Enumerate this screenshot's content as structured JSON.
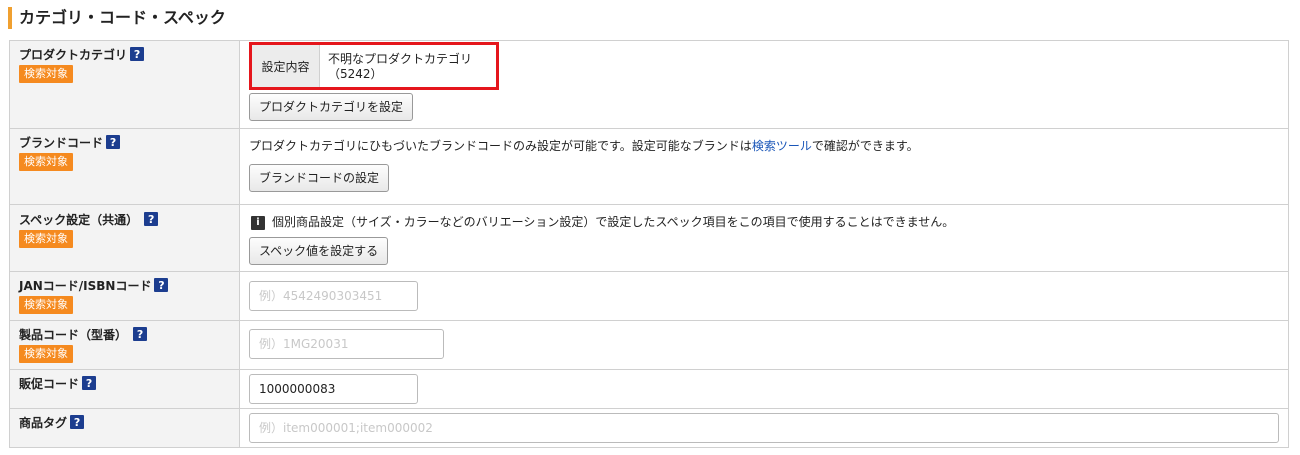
{
  "section_title": "カテゴリ・コード・スペック",
  "search_badge": "検索対象",
  "help_glyph": "?",
  "rows": {
    "product_category": {
      "label": "プロダクトカテゴリ",
      "setting_key": "設定内容",
      "setting_value_line1": "不明なプロダクトカテゴリ",
      "setting_value_line2": "（5242）",
      "button": "プロダクトカテゴリを設定"
    },
    "brand_code": {
      "label": "ブランドコード",
      "desc_before": "プロダクトカテゴリにひもづいたブランドコードのみ設定が可能です。設定可能なブランドは",
      "desc_link": "検索ツール",
      "desc_after": "で確認ができます。",
      "button": "ブランドコードの設定"
    },
    "spec": {
      "label": "スペック設定（共通）",
      "info_glyph": "i",
      "info_text": "個別商品設定（サイズ・カラーなどのバリエーション設定）で設定したスペック項目をこの項目で使用することはできません。",
      "button": "スペック値を設定する"
    },
    "jan": {
      "label": "JANコード/ISBNコード",
      "placeholder": "例）4542490303451",
      "value": ""
    },
    "model": {
      "label": "製品コード（型番）",
      "placeholder": "例）1MG20031",
      "value": ""
    },
    "promo": {
      "label": "販促コード",
      "placeholder": "",
      "value": "1000000083"
    },
    "tags": {
      "label": "商品タグ",
      "placeholder": "例）item000001;item000002",
      "value": ""
    }
  },
  "colors": {
    "accent_bar": "#f0a030",
    "badge": "#f58a1f",
    "help_icon": "#1c3d8f",
    "highlight_border": "#e5161c",
    "link": "#1a56b8"
  }
}
